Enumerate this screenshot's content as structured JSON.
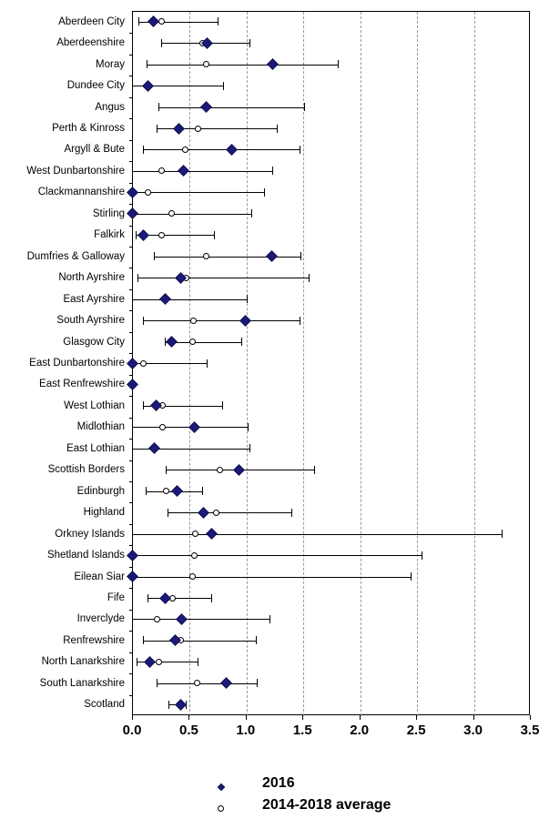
{
  "chart_data": {
    "type": "scatter",
    "title": "",
    "subtitle": "",
    "xlabel": "",
    "ylabel": "",
    "xlim": [
      0.0,
      3.5
    ],
    "xticks": [
      "0.0",
      "0.5",
      "1.0",
      "1.5",
      "2.0",
      "2.5",
      "3.0",
      "3.5"
    ],
    "xtick_values": [
      0.0,
      0.5,
      1.0,
      1.5,
      2.0,
      2.5,
      3.0,
      3.5
    ],
    "grid": "vertical-dashed",
    "legend_position": "bottom",
    "series": [
      {
        "name": "2016",
        "marker": "filled-diamond",
        "color": "#1a1a7a"
      },
      {
        "name": "2014-2018 average",
        "marker": "open-circle",
        "color": "#000000"
      }
    ],
    "categories": [
      "Aberdeen City",
      "Aberdeenshire",
      "Moray",
      "Dundee City",
      "Angus",
      "Perth & Kinross",
      "Argyll & Bute",
      "West Dunbartonshire",
      "Clackmannanshire",
      "Stirling",
      "Falkirk",
      "Dumfries & Galloway",
      "North Ayrshire",
      "East Ayrshire",
      "South Ayrshire",
      "Glasgow City",
      "East Dunbartonshire",
      "East Renfrewshire",
      "West Lothian",
      "Midlothian",
      "East Lothian",
      "Scottish Borders",
      "Edinburgh",
      "Highland",
      "Orkney Islands",
      "Shetland Islands",
      "Eilean Siar",
      "Fife",
      "Inverclyde",
      "Renfrewshire",
      "North Lanarkshire",
      "South Lanarkshire",
      "Scotland"
    ],
    "rows": [
      {
        "category": "Aberdeen City",
        "value_2016": 0.19,
        "average_2014_2018": 0.26,
        "range_low": 0.06,
        "range_high": 0.75
      },
      {
        "category": "Aberdeenshire",
        "value_2016": 0.66,
        "average_2014_2018": 0.62,
        "range_low": 0.26,
        "range_high": 1.03
      },
      {
        "category": "Moray",
        "value_2016": 1.24,
        "average_2014_2018": 0.65,
        "range_low": 0.13,
        "range_high": 1.81
      },
      {
        "category": "Dundee City",
        "value_2016": 0.14,
        "average_2014_2018": 0.14,
        "range_low": 0.0,
        "range_high": 0.8
      },
      {
        "category": "Angus",
        "value_2016": 0.65,
        "average_2014_2018": 0.65,
        "range_low": 0.23,
        "range_high": 1.51
      },
      {
        "category": "Perth & Kinross",
        "value_2016": 0.41,
        "average_2014_2018": 0.58,
        "range_low": 0.22,
        "range_high": 1.27
      },
      {
        "category": "Argyll & Bute",
        "value_2016": 0.88,
        "average_2014_2018": 0.47,
        "range_low": 0.1,
        "range_high": 1.47
      },
      {
        "category": "West Dunbartonshire",
        "value_2016": 0.45,
        "average_2014_2018": 0.26,
        "range_low": 0.0,
        "range_high": 1.23
      },
      {
        "category": "Clackmannanshire",
        "value_2016": 0.0,
        "average_2014_2018": 0.14,
        "range_low": 0.0,
        "range_high": 1.16
      },
      {
        "category": "Stirling",
        "value_2016": 0.0,
        "average_2014_2018": 0.35,
        "range_low": 0.0,
        "range_high": 1.05
      },
      {
        "category": "Falkirk",
        "value_2016": 0.1,
        "average_2014_2018": 0.26,
        "range_low": 0.03,
        "range_high": 0.72
      },
      {
        "category": "Dumfries & Galloway",
        "value_2016": 1.23,
        "average_2014_2018": 0.65,
        "range_low": 0.19,
        "range_high": 1.48
      },
      {
        "category": "North Ayrshire",
        "value_2016": 0.43,
        "average_2014_2018": 0.48,
        "range_low": 0.05,
        "range_high": 1.55
      },
      {
        "category": "East Ayrshire",
        "value_2016": 0.29,
        "average_2014_2018": 0.29,
        "range_low": 0.0,
        "range_high": 1.01
      },
      {
        "category": "South Ayrshire",
        "value_2016": 1.0,
        "average_2014_2018": 0.54,
        "range_low": 0.1,
        "range_high": 1.47
      },
      {
        "category": "Glasgow City",
        "value_2016": 0.35,
        "average_2014_2018": 0.53,
        "range_low": 0.29,
        "range_high": 0.96
      },
      {
        "category": "East Dunbartonshire",
        "value_2016": 0.0,
        "average_2014_2018": 0.1,
        "range_low": 0.0,
        "range_high": 0.66
      },
      {
        "category": "East Renfrewshire",
        "value_2016": 0.0,
        "average_2014_2018": 0.0,
        "range_low": 0.0,
        "range_high": 0.0
      },
      {
        "category": "West Lothian",
        "value_2016": 0.21,
        "average_2014_2018": 0.27,
        "range_low": 0.1,
        "range_high": 0.79
      },
      {
        "category": "Midlothian",
        "value_2016": 0.55,
        "average_2014_2018": 0.27,
        "range_low": 0.0,
        "range_high": 1.02
      },
      {
        "category": "East Lothian",
        "value_2016": 0.2,
        "average_2014_2018": 0.2,
        "range_low": 0.0,
        "range_high": 1.03
      },
      {
        "category": "Scottish Borders",
        "value_2016": 0.94,
        "average_2014_2018": 0.77,
        "range_low": 0.3,
        "range_high": 1.6
      },
      {
        "category": "Edinburgh",
        "value_2016": 0.4,
        "average_2014_2018": 0.3,
        "range_low": 0.12,
        "range_high": 0.62
      },
      {
        "category": "Highland",
        "value_2016": 0.63,
        "average_2014_2018": 0.74,
        "range_low": 0.31,
        "range_high": 1.4
      },
      {
        "category": "Orkney Islands",
        "value_2016": 0.7,
        "average_2014_2018": 0.56,
        "range_low": 0.0,
        "range_high": 3.25
      },
      {
        "category": "Shetland Islands",
        "value_2016": 0.0,
        "average_2014_2018": 0.55,
        "range_low": 0.0,
        "range_high": 2.55
      },
      {
        "category": "Eilean Siar",
        "value_2016": 0.0,
        "average_2014_2018": 0.53,
        "range_low": 0.0,
        "range_high": 2.45
      },
      {
        "category": "Fife",
        "value_2016": 0.29,
        "average_2014_2018": 0.36,
        "range_low": 0.14,
        "range_high": 0.7
      },
      {
        "category": "Inverclyde",
        "value_2016": 0.44,
        "average_2014_2018": 0.22,
        "range_low": 0.0,
        "range_high": 1.21
      },
      {
        "category": "Renfrewshire",
        "value_2016": 0.38,
        "average_2014_2018": 0.43,
        "range_low": 0.1,
        "range_high": 1.09
      },
      {
        "category": "North Lanarkshire",
        "value_2016": 0.16,
        "average_2014_2018": 0.24,
        "range_low": 0.04,
        "range_high": 0.58
      },
      {
        "category": "South Lanarkshire",
        "value_2016": 0.83,
        "average_2014_2018": 0.57,
        "range_low": 0.22,
        "range_high": 1.1
      },
      {
        "category": "Scotland",
        "value_2016": 0.43,
        "average_2014_2018": 0.42,
        "range_low": 0.32,
        "range_high": 0.47
      }
    ]
  },
  "legend": {
    "items": [
      {
        "label": "2016",
        "marker": "filled-diamond"
      },
      {
        "label": "2014-2018 average",
        "marker": "open-circle"
      }
    ]
  },
  "colors": {
    "marker_2016": "#1a1a7a",
    "line": "#000000",
    "grid": "#9a9a9a",
    "background": "#ffffff"
  }
}
